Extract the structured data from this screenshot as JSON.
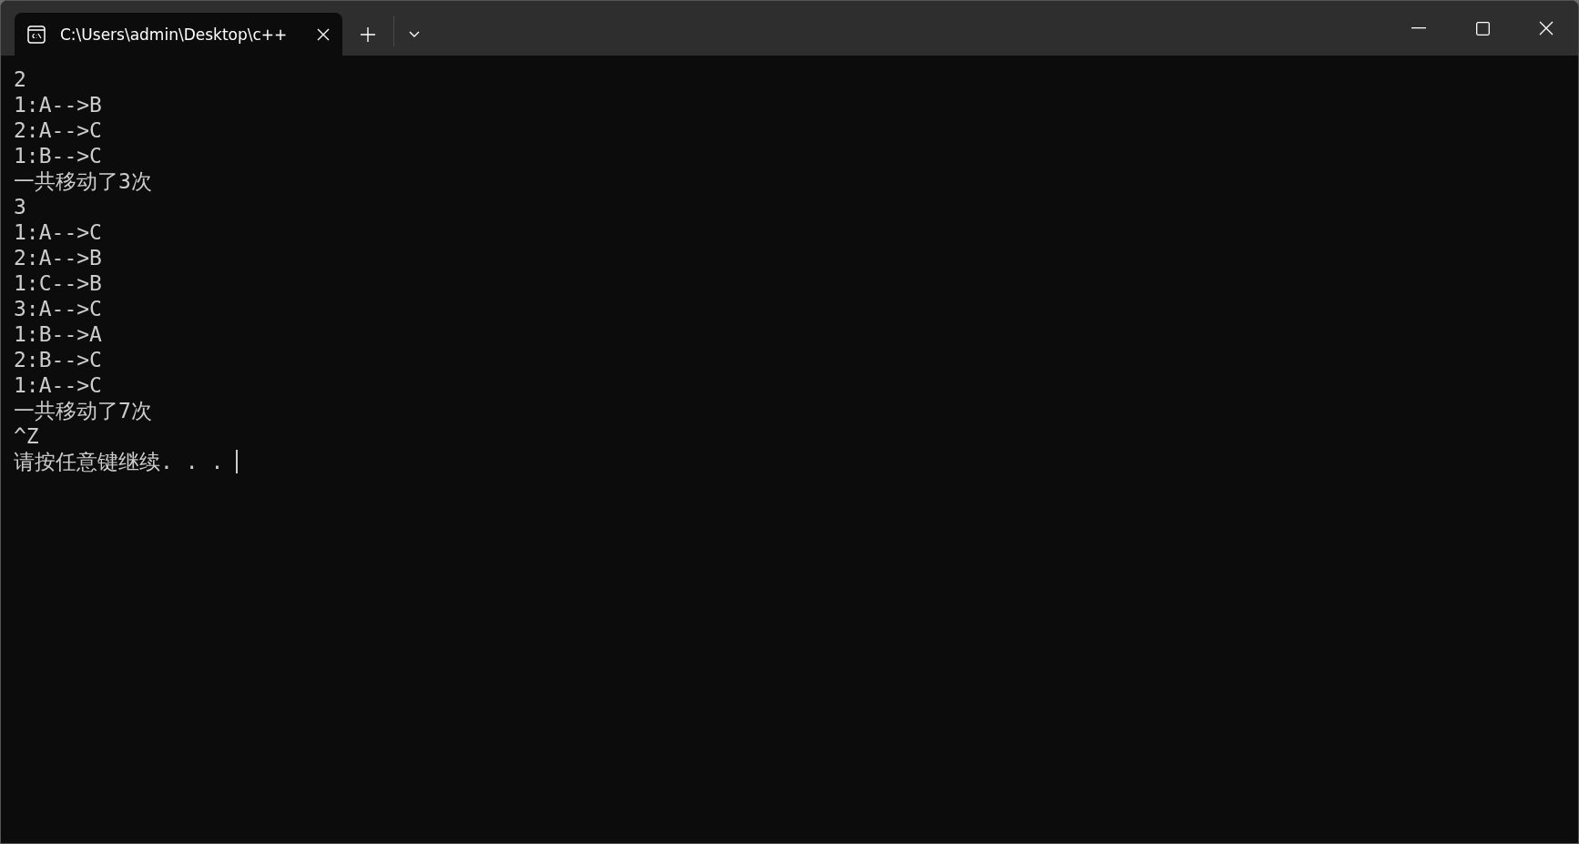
{
  "window": {
    "tabs": [
      {
        "title": "C:\\Users\\admin\\Desktop\\c++",
        "selected": true
      }
    ]
  },
  "console": {
    "lines": [
      "2",
      "1:A-->B",
      "2:A-->C",
      "1:B-->C",
      "一共移动了3次",
      "3",
      "1:A-->C",
      "2:A-->B",
      "1:C-->B",
      "3:A-->C",
      "1:B-->A",
      "2:B-->C",
      "1:A-->C",
      "一共移动了7次",
      "^Z",
      "请按任意键继续. . . "
    ],
    "cursor": true
  }
}
